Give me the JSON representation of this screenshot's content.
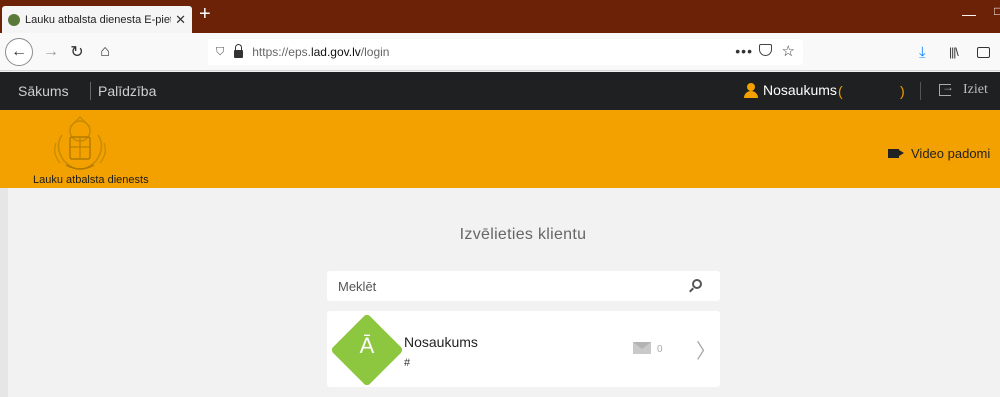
{
  "browser": {
    "tab_title": "Lauku atbalsta dienesta E-pieteikšanās sistēma",
    "url_prefix": "https://eps.",
    "url_domain": "lad.gov.lv",
    "url_path": "/login",
    "more_label": "•••"
  },
  "site_nav": {
    "home": "Sākums",
    "help": "Palīdzība",
    "user_name": "Nosaukums",
    "paren_open": "(",
    "paren_close": ")",
    "logout": "Iziet"
  },
  "header": {
    "brand": "Lauku atbalsta dienests",
    "video_tips": "Video padomi",
    "accent_color": "#f3a100"
  },
  "main": {
    "heading": "Izvēlieties klientu",
    "search_placeholder": "Meklēt",
    "client": {
      "badge_letter": "Ā",
      "name": "Nosaukums",
      "number": "#",
      "message_count": "0",
      "badge_color": "#8dc63f"
    }
  }
}
